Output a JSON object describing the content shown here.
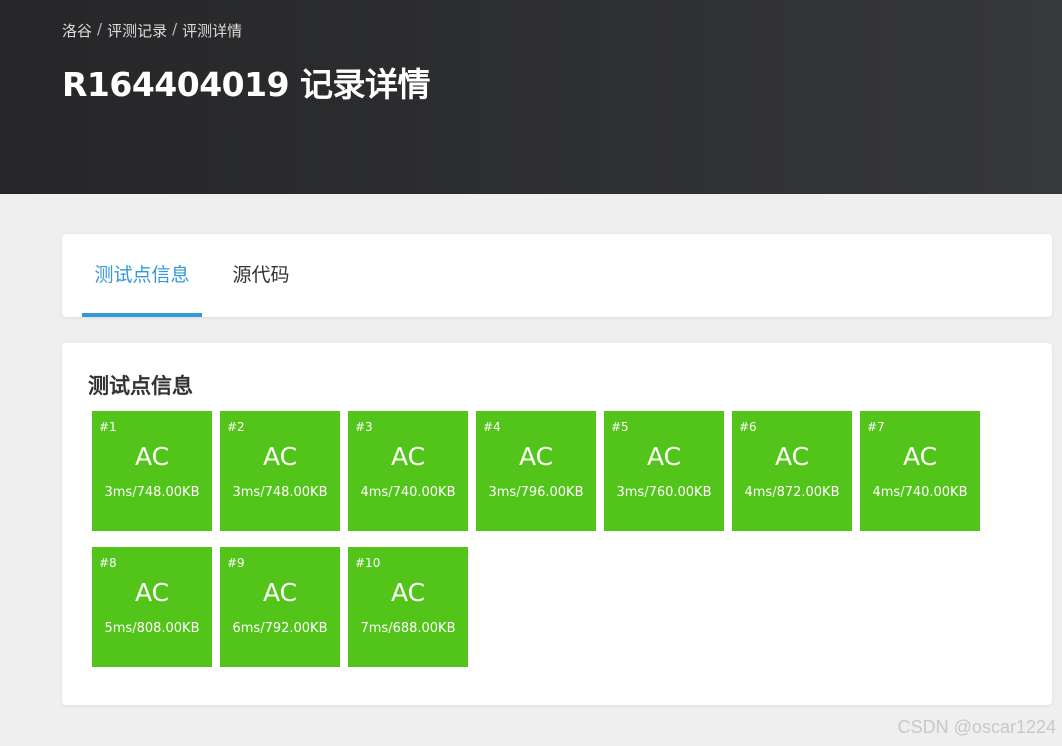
{
  "header": {
    "breadcrumb": [
      "洛谷",
      "评测记录",
      "评测详情"
    ],
    "title": "R164404019 记录详情"
  },
  "tabs": [
    {
      "label": "测试点信息",
      "active": true
    },
    {
      "label": "源代码",
      "active": false
    }
  ],
  "section": {
    "title": "测试点信息",
    "testcases": [
      {
        "id": "#1",
        "status": "AC",
        "info": "3ms/748.00KB"
      },
      {
        "id": "#2",
        "status": "AC",
        "info": "3ms/748.00KB"
      },
      {
        "id": "#3",
        "status": "AC",
        "info": "4ms/740.00KB"
      },
      {
        "id": "#4",
        "status": "AC",
        "info": "3ms/796.00KB"
      },
      {
        "id": "#5",
        "status": "AC",
        "info": "3ms/760.00KB"
      },
      {
        "id": "#6",
        "status": "AC",
        "info": "4ms/872.00KB"
      },
      {
        "id": "#7",
        "status": "AC",
        "info": "4ms/740.00KB"
      },
      {
        "id": "#8",
        "status": "AC",
        "info": "5ms/808.00KB"
      },
      {
        "id": "#9",
        "status": "AC",
        "info": "6ms/792.00KB"
      },
      {
        "id": "#10",
        "status": "AC",
        "info": "7ms/688.00KB"
      }
    ]
  },
  "colors": {
    "accepted": "#52c41a",
    "accent": "#3498db"
  },
  "watermark": "CSDN @oscar1224"
}
